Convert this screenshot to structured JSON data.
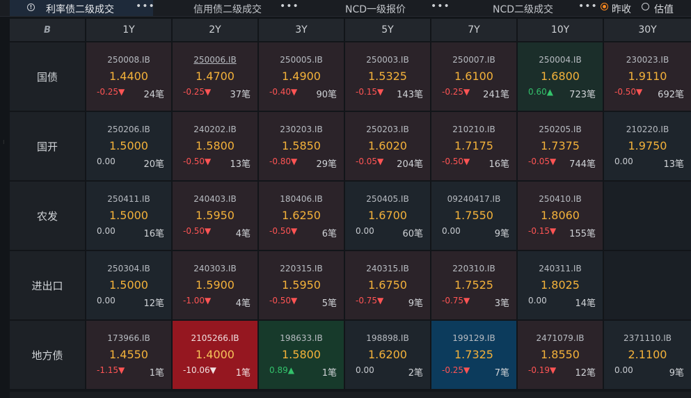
{
  "tabs": [
    {
      "label": "利率债二级成交",
      "more": "•••",
      "active": true
    },
    {
      "label": "信用债二级成交",
      "more": "•••",
      "active": false
    },
    {
      "label": "NCD一级报价",
      "more": "•••",
      "active": false
    },
    {
      "label": "NCD二级成交",
      "more": "•••",
      "active": false
    }
  ],
  "radio": {
    "options": [
      "昨收",
      "估值"
    ],
    "selected": "昨收"
  },
  "colors": {
    "accent": "#ff8a1f",
    "price": "#f4b23a",
    "up": "#33c26b",
    "down": "#ff5454"
  },
  "header": {
    "logo": "B",
    "columns": [
      "1Y",
      "2Y",
      "3Y",
      "5Y",
      "7Y",
      "10Y",
      "30Y"
    ]
  },
  "rows": [
    {
      "label": "国债",
      "cells": [
        {
          "code": "250008.IB",
          "price": "1.4400",
          "chg": "-0.25▼",
          "count": "24笔",
          "bg": "red",
          "dir": "down"
        },
        {
          "code": "250006.IB",
          "price": "1.4700",
          "chg": "-0.25▼",
          "count": "37笔",
          "bg": "red",
          "dir": "down",
          "underline": true
        },
        {
          "code": "250005.IB",
          "price": "1.4900",
          "chg": "-0.40▼",
          "count": "90笔",
          "bg": "red",
          "dir": "down"
        },
        {
          "code": "250003.IB",
          "price": "1.5325",
          "chg": "-0.15▼",
          "count": "143笔",
          "bg": "red",
          "dir": "down"
        },
        {
          "code": "250007.IB",
          "price": "1.6100",
          "chg": "-0.25▼",
          "count": "241笔",
          "bg": "red",
          "dir": "down"
        },
        {
          "code": "250004.IB",
          "price": "1.6800",
          "chg": "0.60▲",
          "count": "723笔",
          "bg": "green",
          "dir": "up"
        },
        {
          "code": "230023.IB",
          "price": "1.9110",
          "chg": "-0.50▼",
          "count": "692笔",
          "bg": "red",
          "dir": "down"
        }
      ]
    },
    {
      "label": "国开",
      "cells": [
        {
          "code": "250206.IB",
          "price": "1.5000",
          "chg": "0.00",
          "count": "20笔",
          "bg": "gray",
          "dir": "zero"
        },
        {
          "code": "240202.IB",
          "price": "1.5800",
          "chg": "-0.50▼",
          "count": "13笔",
          "bg": "red",
          "dir": "down"
        },
        {
          "code": "230203.IB",
          "price": "1.5850",
          "chg": "-0.80▼",
          "count": "29笔",
          "bg": "red",
          "dir": "down"
        },
        {
          "code": "250203.IB",
          "price": "1.6020",
          "chg": "-0.05▼",
          "count": "204笔",
          "bg": "red",
          "dir": "down"
        },
        {
          "code": "210210.IB",
          "price": "1.7175",
          "chg": "-0.50▼",
          "count": "16笔",
          "bg": "red",
          "dir": "down"
        },
        {
          "code": "250205.IB",
          "price": "1.7375",
          "chg": "-0.05▼",
          "count": "744笔",
          "bg": "red",
          "dir": "down"
        },
        {
          "code": "210220.IB",
          "price": "1.9750",
          "chg": "0.00",
          "count": "13笔",
          "bg": "gray",
          "dir": "zero"
        }
      ]
    },
    {
      "label": "农发",
      "cells": [
        {
          "code": "250411.IB",
          "price": "1.5000",
          "chg": "0.00",
          "count": "16笔",
          "bg": "gray",
          "dir": "zero"
        },
        {
          "code": "240403.IB",
          "price": "1.5950",
          "chg": "-0.50▼",
          "count": "4笔",
          "bg": "red",
          "dir": "down"
        },
        {
          "code": "180406.IB",
          "price": "1.6250",
          "chg": "-0.50▼",
          "count": "6笔",
          "bg": "red",
          "dir": "down"
        },
        {
          "code": "250405.IB",
          "price": "1.6700",
          "chg": "0.00",
          "count": "60笔",
          "bg": "gray",
          "dir": "zero"
        },
        {
          "code": "09240417.IB",
          "price": "1.7550",
          "chg": "0.00",
          "count": "9笔",
          "bg": "gray",
          "dir": "zero"
        },
        {
          "code": "250410.IB",
          "price": "1.8060",
          "chg": "-0.15▼",
          "count": "155笔",
          "bg": "red",
          "dir": "down"
        },
        {
          "code": "",
          "price": "",
          "chg": "",
          "count": "",
          "bg": "empty",
          "dir": "zero"
        }
      ]
    },
    {
      "label": "进出口",
      "cells": [
        {
          "code": "250304.IB",
          "price": "1.5000",
          "chg": "0.00",
          "count": "12笔",
          "bg": "gray",
          "dir": "zero"
        },
        {
          "code": "240303.IB",
          "price": "1.5900",
          "chg": "-1.00▼",
          "count": "4笔",
          "bg": "red",
          "dir": "down"
        },
        {
          "code": "220315.IB",
          "price": "1.5950",
          "chg": "-0.50▼",
          "count": "5笔",
          "bg": "red",
          "dir": "down"
        },
        {
          "code": "240315.IB",
          "price": "1.6750",
          "chg": "-0.75▼",
          "count": "9笔",
          "bg": "red",
          "dir": "down"
        },
        {
          "code": "220310.IB",
          "price": "1.7525",
          "chg": "-0.75▼",
          "count": "3笔",
          "bg": "red",
          "dir": "down"
        },
        {
          "code": "240311.IB",
          "price": "1.8025",
          "chg": "0.00",
          "count": "14笔",
          "bg": "gray",
          "dir": "zero"
        },
        {
          "code": "",
          "price": "",
          "chg": "",
          "count": "",
          "bg": "empty",
          "dir": "zero"
        }
      ]
    },
    {
      "label": "地方债",
      "cells": [
        {
          "code": "173966.IB",
          "price": "1.4550",
          "chg": "-1.15▼",
          "count": "1笔",
          "bg": "red",
          "dir": "down"
        },
        {
          "code": "2105266.IB",
          "price": "1.4000",
          "chg": "-10.06▼",
          "count": "1笔",
          "bg": "strong-red",
          "dir": "down"
        },
        {
          "code": "198633.IB",
          "price": "1.5800",
          "chg": "0.89▲",
          "count": "1笔",
          "bg": "strong-green",
          "dir": "up"
        },
        {
          "code": "198898.IB",
          "price": "1.6200",
          "chg": "0.00",
          "count": "2笔",
          "bg": "gray",
          "dir": "zero"
        },
        {
          "code": "199129.IB",
          "price": "1.7325",
          "chg": "-0.25▼",
          "count": "7笔",
          "bg": "blue",
          "dir": "down"
        },
        {
          "code": "2471079.IB",
          "price": "1.8550",
          "chg": "-0.19▼",
          "count": "12笔",
          "bg": "red",
          "dir": "down"
        },
        {
          "code": "2371110.IB",
          "price": "2.1100",
          "chg": "0.00",
          "count": "9笔",
          "bg": "gray",
          "dir": "zero"
        }
      ]
    }
  ]
}
